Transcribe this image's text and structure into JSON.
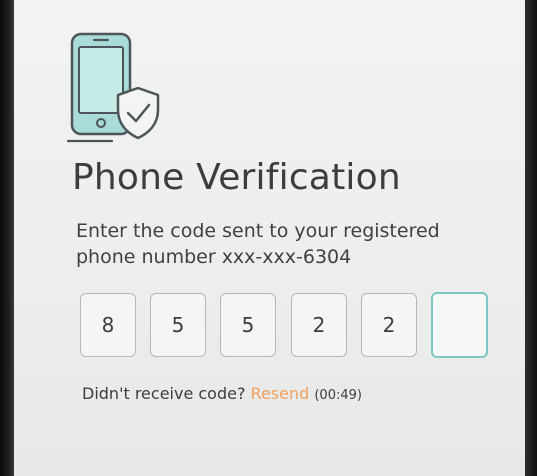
{
  "title": "Phone Verification",
  "instructions": {
    "line1": "Enter the code sent to your registered",
    "line2": "phone number xxx-xxx-6304"
  },
  "otp": {
    "digits": [
      "8",
      "5",
      "5",
      "2",
      "2",
      ""
    ],
    "active_index": 5
  },
  "resend": {
    "prompt": "Didn't receive code?",
    "link_label": "Resend",
    "timer": "(00:49)"
  },
  "colors": {
    "accent_teal": "#7cc7c3",
    "resend_orange": "#f0a05a",
    "text_dark": "#3b3d3f"
  },
  "icons": {
    "hero": "phone-shield-check-icon"
  }
}
